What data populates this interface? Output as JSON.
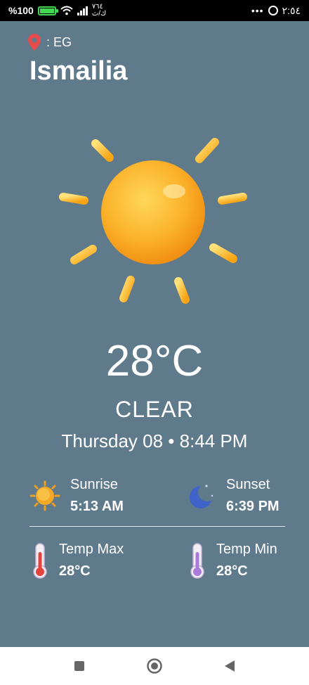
{
  "status_bar": {
    "battery_percent": "%100",
    "carrier": "٧٦٤\nك/ث",
    "time": "٢:٥٤",
    "icons": [
      "battery-icon",
      "wifi-icon",
      "signal-icon",
      "more-dots-icon",
      "whatsapp-icon"
    ]
  },
  "location": {
    "country_label": ": EG",
    "city": "Ismailia"
  },
  "weather": {
    "temperature": "28°C",
    "condition": "CLEAR",
    "datetime": "Thursday 08 • 8:44 PM"
  },
  "details": {
    "sunrise": {
      "label": "Sunrise",
      "value": "5:13 AM",
      "icon": "sunrise-icon"
    },
    "sunset": {
      "label": "Sunset",
      "value": "6:39 PM",
      "icon": "moon-icon"
    },
    "temp_max": {
      "label": "Temp Max",
      "value": "28°C",
      "icon": "thermometer-hot-icon"
    },
    "temp_min": {
      "label": "Temp Min",
      "value": "28°C",
      "icon": "thermometer-cold-icon"
    }
  },
  "nav": [
    "recent-apps-button",
    "home-button",
    "back-button"
  ],
  "colors": {
    "background": "#5f7a8b",
    "pin": "#e84b4b",
    "sun": "#f7a81b",
    "battery": "#43d854"
  }
}
